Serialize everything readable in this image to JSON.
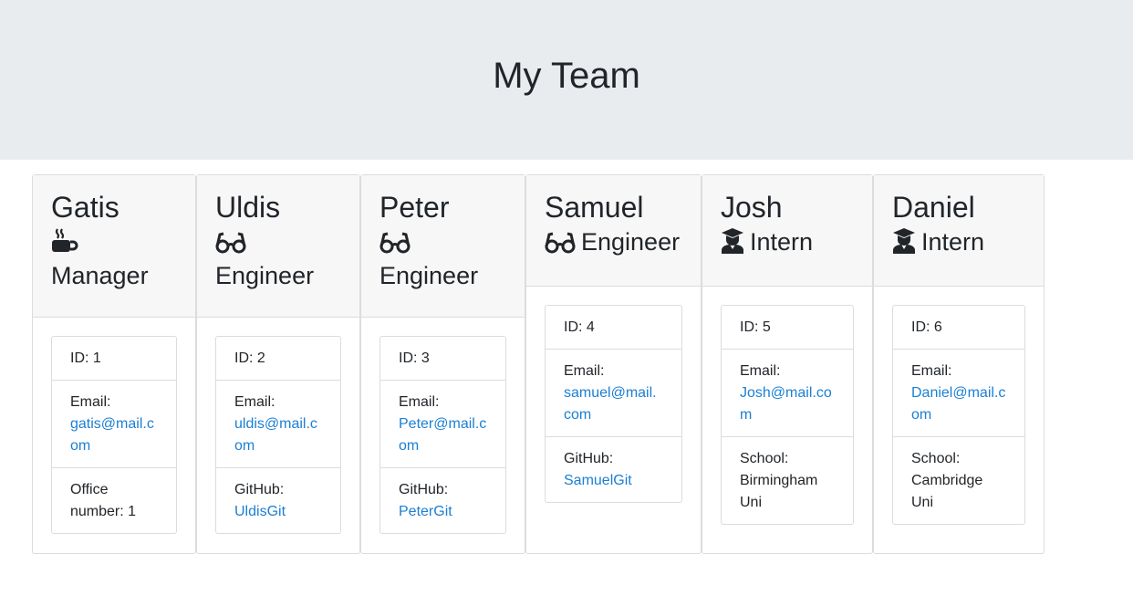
{
  "header": {
    "title": "My Team"
  },
  "team": [
    {
      "name": "Gatis",
      "role": "Manager",
      "icon": "coffee-icon",
      "id_label": "ID: 1",
      "email_label": "Email:",
      "email": "gatis@mail.com",
      "extra_label": "Office number: 1",
      "extra_value": ""
    },
    {
      "name": "Uldis",
      "role": "Engineer",
      "icon": "glasses-icon",
      "id_label": "ID: 2",
      "email_label": "Email:",
      "email": "uldis@mail.com",
      "extra_label": "GitHub:",
      "extra_value": "UldisGit"
    },
    {
      "name": "Peter",
      "role": "Engineer",
      "icon": "glasses-icon",
      "id_label": "ID: 3",
      "email_label": "Email:",
      "email": "Peter@mail.com",
      "extra_label": "GitHub:",
      "extra_value": "PeterGit"
    },
    {
      "name": "Samuel",
      "role": "Engineer",
      "icon": "glasses-icon",
      "id_label": "ID: 4",
      "email_label": "Email:",
      "email": "samuel@mail.com",
      "extra_label": "GitHub:",
      "extra_value": "SamuelGit"
    },
    {
      "name": "Josh",
      "role": "Intern",
      "icon": "graduate-icon",
      "id_label": "ID: 5",
      "email_label": "Email:",
      "email": "Josh@mail.com",
      "extra_label": "School:",
      "extra_value": "Birmingham Uni"
    },
    {
      "name": "Daniel",
      "role": "Intern",
      "icon": "graduate-icon",
      "id_label": "ID: 6",
      "email_label": "Email:",
      "email": "Daniel@mail.com",
      "extra_label": "School:",
      "extra_value": "Cambridge Uni"
    }
  ],
  "colors": {
    "link": "#1b7fd4",
    "header_bg": "#e9ecef",
    "card_header_bg": "#f7f7f7"
  }
}
